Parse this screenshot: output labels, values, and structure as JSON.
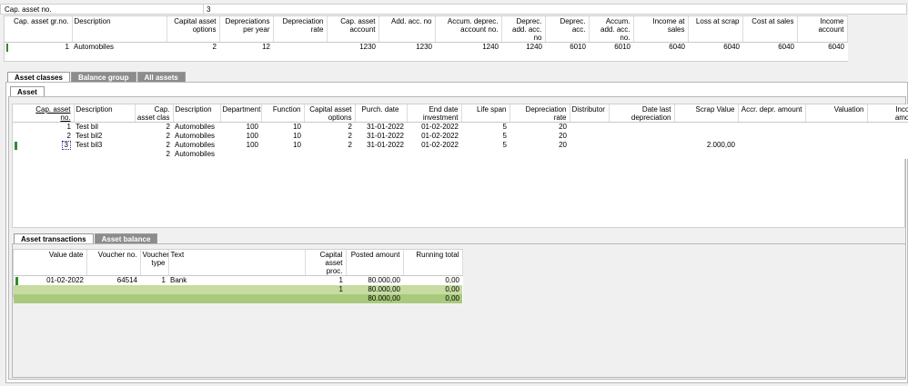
{
  "cap_asset_field": {
    "label": "Cap. asset no.",
    "value": "3"
  },
  "top_table": {
    "headers": [
      "Cap. asset gr.no.",
      "Description",
      "Capital asset options",
      "Depreciations per year",
      "Depreciation rate",
      "Cap. asset account",
      "Add. acc. no",
      "Accum. deprec. account no.",
      "Deprec. add. acc. no",
      "Deprec. acc.",
      "Accum. add. acc. no.",
      "Income at sales",
      "Loss at scrap",
      "Cost at sales",
      "Income account"
    ],
    "row": [
      "1",
      "Automobiles",
      "2",
      "12",
      "",
      "1230",
      "1230",
      "1240",
      "1240",
      "6010",
      "6010",
      "6040",
      "6040",
      "6040",
      "6040"
    ]
  },
  "outer_tabs": [
    "Asset classes",
    "Balance group",
    "All assets"
  ],
  "inner_tab": "Asset",
  "asset_table": {
    "headers": [
      "Cap. asset no.",
      "Description",
      "Cap. asset clas",
      "Description",
      "Department",
      "Function",
      "Capital asset options",
      "Purch. date",
      "End date investment",
      "Life span",
      "Depreciation rate",
      "Distributor",
      "Date last depreciation",
      "Scrap Value",
      "Accr. depr. amount",
      "Valuation",
      "Income amount"
    ],
    "rows": [
      [
        "1",
        "Test bil",
        "2",
        "Automobiles",
        "100",
        "10",
        "2",
        "31-01-2022",
        "01-02-2022",
        "5",
        "20",
        "",
        "",
        "",
        "",
        "",
        ""
      ],
      [
        "2",
        "Test bil2",
        "2",
        "Automobiles",
        "100",
        "10",
        "2",
        "31-01-2022",
        "01-02-2022",
        "5",
        "20",
        "",
        "",
        "",
        "",
        "",
        ""
      ],
      [
        "3",
        "Test bil3",
        "2",
        "Automobiles",
        "100",
        "10",
        "2",
        "31-01-2022",
        "01-02-2022",
        "5",
        "20",
        "",
        "",
        "2.000,00",
        "",
        "",
        ""
      ],
      [
        "",
        "",
        "2",
        "Automobiles",
        "",
        "",
        "",
        "",
        "",
        "",
        "",
        "",
        "",
        "",
        "",
        "",
        ""
      ]
    ]
  },
  "trans_tabs": [
    "Asset transactions",
    "Asset balance"
  ],
  "trans_table": {
    "headers": [
      "Value date",
      "Voucher no.",
      "Voucher type",
      "Text",
      "Capital asset proc.",
      "Posted amount",
      "Running total"
    ],
    "rows": [
      [
        "01-02-2022",
        "64514",
        "1",
        "Bank",
        "1",
        "80.000,00",
        "0,00"
      ],
      [
        "",
        "",
        "",
        "",
        "1",
        "80.000,00",
        "0,00"
      ],
      [
        "",
        "",
        "",
        "",
        "",
        "80.000,00",
        "0,00"
      ]
    ]
  }
}
